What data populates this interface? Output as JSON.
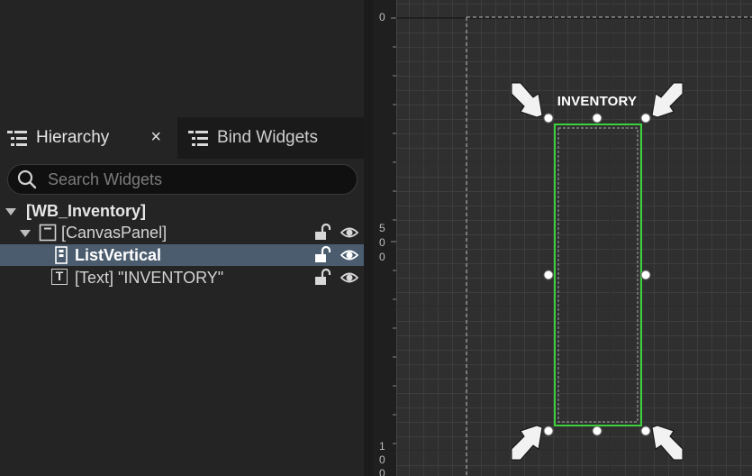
{
  "tabs": {
    "hierarchy_label": "Hierarchy",
    "bind_widgets_label": "Bind Widgets",
    "close_symbol": "×"
  },
  "search": {
    "placeholder": "Search Widgets",
    "value": ""
  },
  "tree": {
    "root": "[WB_Inventory]",
    "canvas_panel": "[CanvasPanel]",
    "list_vertical": "ListVertical",
    "text_item": "[Text] \"INVENTORY\"",
    "text_icon_glyph": "T"
  },
  "designer": {
    "widget_title": "INVENTORY",
    "ruler": {
      "zero": "0",
      "five_hundred_digits": [
        "5",
        "0",
        "0"
      ],
      "thousand_digits": [
        "1",
        "0",
        "0"
      ]
    }
  },
  "colors": {
    "selection_outline": "#3cd13c",
    "selected_row": "#4a5c6e"
  }
}
